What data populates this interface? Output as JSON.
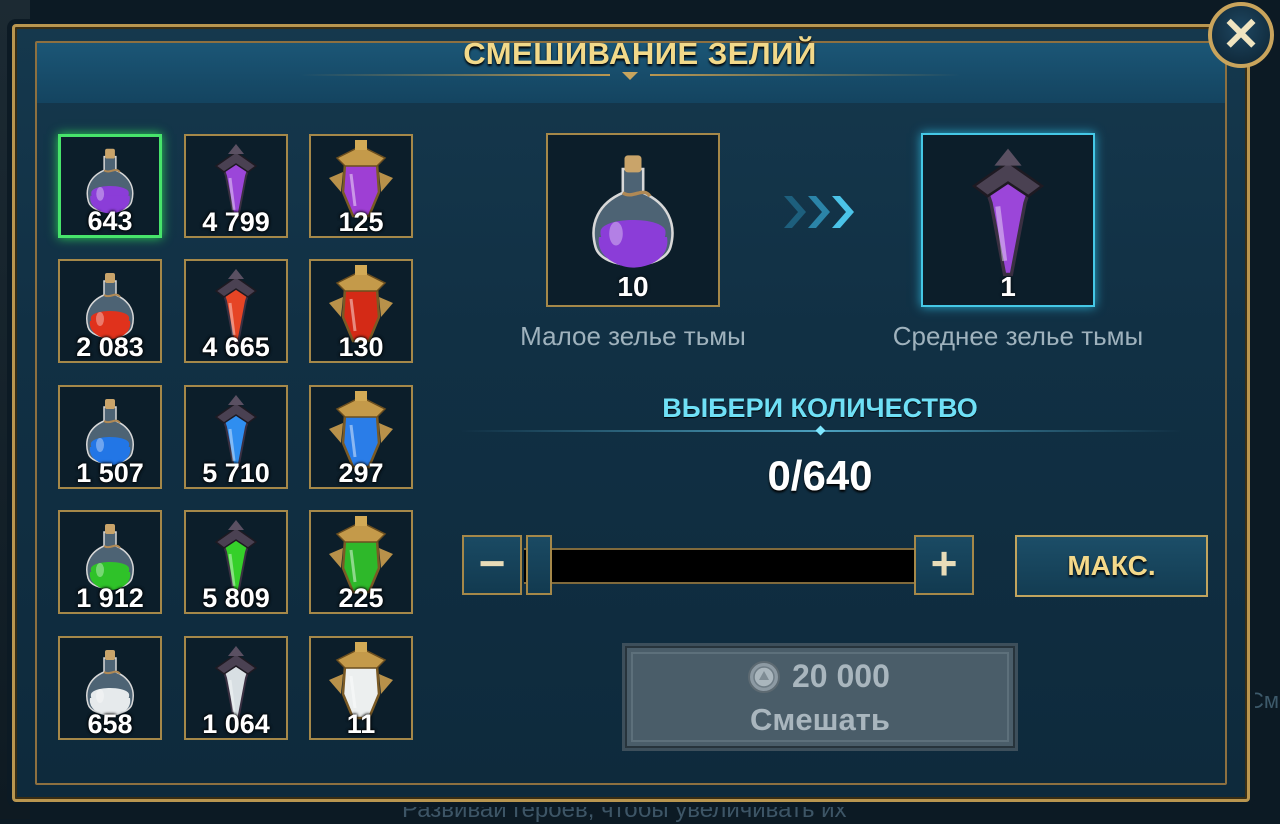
{
  "title": "СМЕШИВАНИЕ ЗЕЛИЙ",
  "close_label": "✕",
  "inventory": [
    {
      "name": "small-void-potion",
      "count": "643",
      "color": "#8b3dd8",
      "shape": "small",
      "selected": true
    },
    {
      "name": "medium-void-potion",
      "count": "4 799",
      "color": "#9b46d9",
      "shape": "medium"
    },
    {
      "name": "large-void-potion",
      "count": "125",
      "color": "#9e3fd4",
      "shape": "large"
    },
    {
      "name": "small-force-potion",
      "count": "2 083",
      "color": "#e0321c",
      "shape": "small"
    },
    {
      "name": "medium-force-potion",
      "count": "4 665",
      "color": "#e64525",
      "shape": "medium"
    },
    {
      "name": "large-force-potion",
      "count": "130",
      "color": "#d42a16",
      "shape": "large"
    },
    {
      "name": "small-magic-potion",
      "count": "1 507",
      "color": "#2276e6",
      "shape": "small"
    },
    {
      "name": "medium-magic-potion",
      "count": "5 710",
      "color": "#2f8ef0",
      "shape": "medium"
    },
    {
      "name": "large-magic-potion",
      "count": "297",
      "color": "#2a7de8",
      "shape": "large"
    },
    {
      "name": "small-spirit-potion",
      "count": "1 912",
      "color": "#2fc229",
      "shape": "small"
    },
    {
      "name": "medium-spirit-potion",
      "count": "5 809",
      "color": "#35d02a",
      "shape": "medium"
    },
    {
      "name": "large-spirit-potion",
      "count": "225",
      "color": "#2eb82a",
      "shape": "large"
    },
    {
      "name": "small-arcane-potion",
      "count": "658",
      "color": "#e6eaec",
      "shape": "small"
    },
    {
      "name": "medium-arcane-potion",
      "count": "1 064",
      "color": "#d8dfe3",
      "shape": "medium"
    },
    {
      "name": "large-arcane-potion",
      "count": "11",
      "color": "#ecefef",
      "shape": "large"
    }
  ],
  "source": {
    "count": "10",
    "name": "Малое зелье тьмы",
    "color": "#8b3dd8"
  },
  "result": {
    "count": "1",
    "name": "Среднее зелье тьмы",
    "color": "#9b46d9"
  },
  "choose_label": "ВЫБЕРИ КОЛИЧЕСТВО",
  "quantity": "0/640",
  "minus_label": "−",
  "plus_label": "+",
  "max_label": "МАКС.",
  "mix": {
    "cost": "20 000",
    "label": "Смешать"
  },
  "background_text": "Развивай героев, чтобы увеличивать их",
  "background_side_text": "См"
}
